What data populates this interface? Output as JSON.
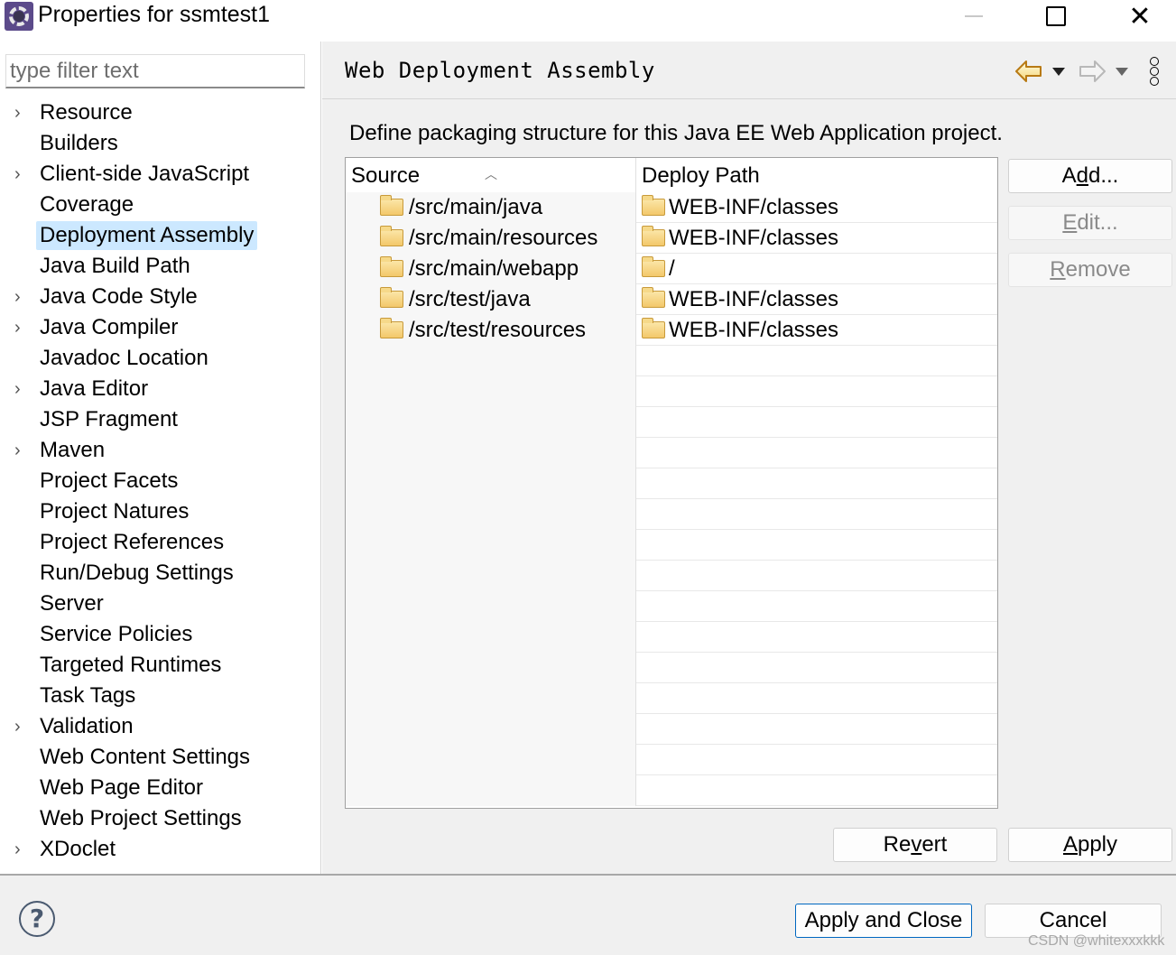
{
  "window": {
    "title": "Properties for ssmtest1",
    "icon": "eclipse-gear-icon",
    "controls": {
      "minimize": "minimize-icon",
      "maximize": "maximize-icon",
      "close": "close-icon"
    }
  },
  "sidebar": {
    "filter_placeholder": "type filter text",
    "filter_value": "",
    "selected": "Deployment Assembly",
    "items": [
      {
        "label": "Resource",
        "expandable": true
      },
      {
        "label": "Builders",
        "expandable": false
      },
      {
        "label": "Client-side JavaScript",
        "expandable": true
      },
      {
        "label": "Coverage",
        "expandable": false
      },
      {
        "label": "Deployment Assembly",
        "expandable": false,
        "selected": true
      },
      {
        "label": "Java Build Path",
        "expandable": false
      },
      {
        "label": "Java Code Style",
        "expandable": true
      },
      {
        "label": "Java Compiler",
        "expandable": true
      },
      {
        "label": "Javadoc Location",
        "expandable": false
      },
      {
        "label": "Java Editor",
        "expandable": true
      },
      {
        "label": "JSP Fragment",
        "expandable": false
      },
      {
        "label": "Maven",
        "expandable": true
      },
      {
        "label": "Project Facets",
        "expandable": false
      },
      {
        "label": "Project Natures",
        "expandable": false
      },
      {
        "label": "Project References",
        "expandable": false
      },
      {
        "label": "Run/Debug Settings",
        "expandable": false
      },
      {
        "label": "Server",
        "expandable": false
      },
      {
        "label": "Service Policies",
        "expandable": false
      },
      {
        "label": "Targeted Runtimes",
        "expandable": false
      },
      {
        "label": "Task Tags",
        "expandable": false
      },
      {
        "label": "Validation",
        "expandable": true
      },
      {
        "label": "Web Content Settings",
        "expandable": false
      },
      {
        "label": "Web Page Editor",
        "expandable": false
      },
      {
        "label": "Web Project Settings",
        "expandable": false
      },
      {
        "label": "XDoclet",
        "expandable": true
      }
    ]
  },
  "page": {
    "title": "Web Deployment Assembly",
    "description": "Define packaging structure for this Java EE Web Application project.",
    "nav": {
      "back": "back-arrow-icon",
      "forward": "forward-arrow-icon",
      "menu": "view-menu-icon"
    },
    "table": {
      "columns": [
        "Source",
        "Deploy Path"
      ],
      "sort_column": "Source",
      "rows": [
        {
          "source": "/src/main/java",
          "deploy_path": "WEB-INF/classes"
        },
        {
          "source": "/src/main/resources",
          "deploy_path": "WEB-INF/classes"
        },
        {
          "source": "/src/main/webapp",
          "deploy_path": "/"
        },
        {
          "source": "/src/test/java",
          "deploy_path": "WEB-INF/classes"
        },
        {
          "source": "/src/test/resources",
          "deploy_path": "WEB-INF/classes"
        }
      ]
    },
    "buttons": {
      "add": {
        "pre": "A",
        "mn": "d",
        "post": "d...",
        "enabled": true
      },
      "edit": {
        "pre": "",
        "mn": "E",
        "post": "dit...",
        "enabled": false
      },
      "remove": {
        "pre": "",
        "mn": "R",
        "post": "emove",
        "enabled": false
      },
      "revert": {
        "pre": "Re",
        "mn": "v",
        "post": "ert"
      },
      "apply": {
        "pre": "",
        "mn": "A",
        "post": "pply"
      }
    }
  },
  "footer": {
    "help_label": "?",
    "apply_and_close": "Apply and Close",
    "cancel": "Cancel",
    "watermark": "CSDN @whitexxxkkk"
  }
}
